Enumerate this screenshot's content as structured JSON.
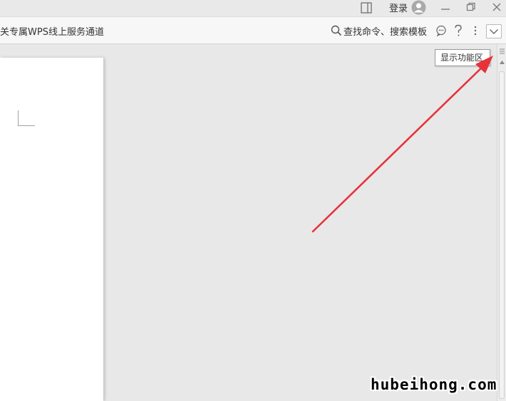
{
  "titlebar": {
    "login_label": "登录",
    "icons": [
      "panel-icon",
      "avatar",
      "minimize-icon",
      "restore-icon",
      "close-icon"
    ]
  },
  "toolbar": {
    "banner_text": "关专属WPS线上服务通道",
    "search_label": "查找命令、搜索模板",
    "icons": [
      "search-icon",
      "feedback-icon",
      "help-icon",
      "more-icon",
      "chevron-down-icon"
    ]
  },
  "tooltip": {
    "text": "显示功能区"
  },
  "watermark": {
    "text": "hubeihong.com"
  },
  "colors": {
    "annotation_arrow": "#e8323a",
    "canvas": "#e8e8e8",
    "toolbar": "#f7f7f7"
  }
}
